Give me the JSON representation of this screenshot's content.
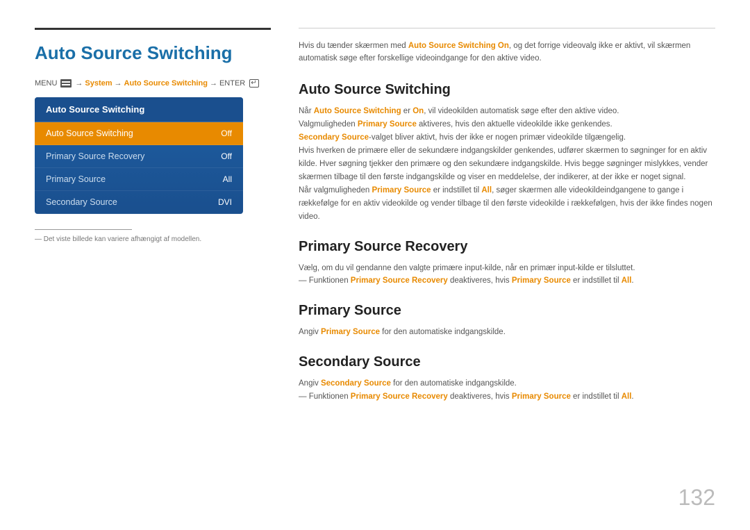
{
  "page": {
    "title": "Auto Source Switching",
    "page_number": "132",
    "footnote": "― Det viste billede kan variere afhængigt af modellen."
  },
  "menu_path": {
    "menu_label": "MENU",
    "system": "System",
    "auto_source": "Auto Source Switching",
    "enter": "ENTER"
  },
  "menu_box": {
    "header": "Auto Source Switching",
    "items": [
      {
        "label": "Auto Source Switching",
        "value": "Off",
        "active": true
      },
      {
        "label": "Primary Source Recovery",
        "value": "Off",
        "active": false
      },
      {
        "label": "Primary Source",
        "value": "All",
        "active": false
      },
      {
        "label": "Secondary Source",
        "value": "DVI",
        "active": false
      }
    ]
  },
  "intro": {
    "text": "Hvis du tænder skærmen med Auto Source Switching On, og det forrige videovalg ikke er aktivt, vil skærmen automatisk søge efter forskellige videoindgange for den aktive video."
  },
  "sections": [
    {
      "id": "auto-source",
      "title": "Auto Source Switching",
      "paragraphs": [
        "Når Auto Source Switching er On, vil videokilden automatisk søge efter den aktive video.",
        "Valgmuligheden Primary Source aktiveres, hvis den aktuelle videokilde ikke genkendes.",
        "Secondary Source-valget bliver aktivt, hvis der ikke er nogen primær videokilde tilgængelig.",
        "Hvis hverken de primære eller de sekundære indgangskilder genkendes, udfører skærmen to søgninger for en aktiv kilde. Hver søgning tjekker den primære og den sekundære indgangskilde. Hvis begge søgninger mislykkes, vender skærmen tilbage til den første indgangskilde og viser en meddelelse, der indikerer, at der ikke er noget signal.",
        "Når valgmuligheden Primary Source er indstillet til All, søger skærmen alle videokildeindgangene to gange i rækkefølge for en aktiv videokilde og vender tilbage til den første videokilde i rækkefølgen, hvis der ikke findes nogen video."
      ]
    },
    {
      "id": "primary-source-recovery",
      "title": "Primary Source Recovery",
      "paragraphs": [
        "Vælg, om du vil gendanne den valgte primære input-kilde, når en primær input-kilde er tilsluttet.",
        "― Funktionen Primary Source Recovery deaktiveres, hvis Primary Source er indstillet til All."
      ]
    },
    {
      "id": "primary-source",
      "title": "Primary Source",
      "paragraphs": [
        "Angiv Primary Source for den automatiske indgangskilde."
      ]
    },
    {
      "id": "secondary-source",
      "title": "Secondary Source",
      "paragraphs": [
        "Angiv Secondary Source for den automatiske indgangskilde.",
        "― Funktionen Primary Source Recovery deaktiveres, hvis Primary Source er indstillet til All."
      ]
    }
  ]
}
